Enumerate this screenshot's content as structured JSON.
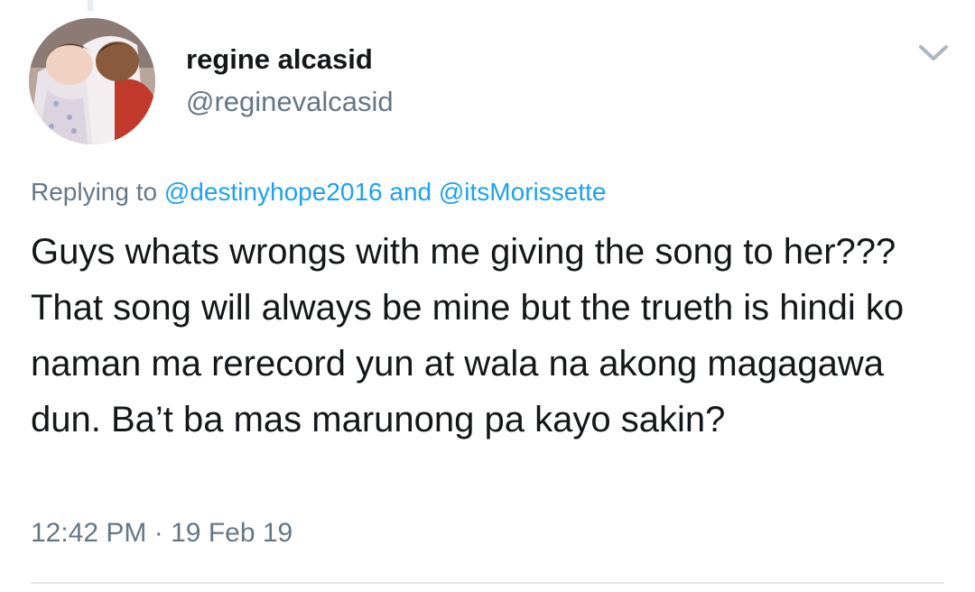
{
  "author": {
    "display_name": "regine alcasid",
    "handle": "@reginevalcasid"
  },
  "reply_context": {
    "prefix": "Replying to",
    "mentions": [
      "@destinyhope2016",
      "@itsMorissette"
    ],
    "joiner": "and"
  },
  "tweet": {
    "text": "Guys whats wrongs with me giving the song to her??? That song will always be mine but the trueth is hindi ko naman ma rerecord yun at wala na akong magagawa dun. Ba’t ba mas marunong pa kayo sakin?"
  },
  "meta": {
    "time": "12:42 PM",
    "separator": "·",
    "date": "19 Feb 19"
  },
  "icons": {
    "menu": "chevron-down-icon",
    "avatar": "profile-photo"
  },
  "colors": {
    "text": "#14171a",
    "secondary": "#657786",
    "link": "#1da1f2",
    "divider": "#e1e8ed"
  }
}
